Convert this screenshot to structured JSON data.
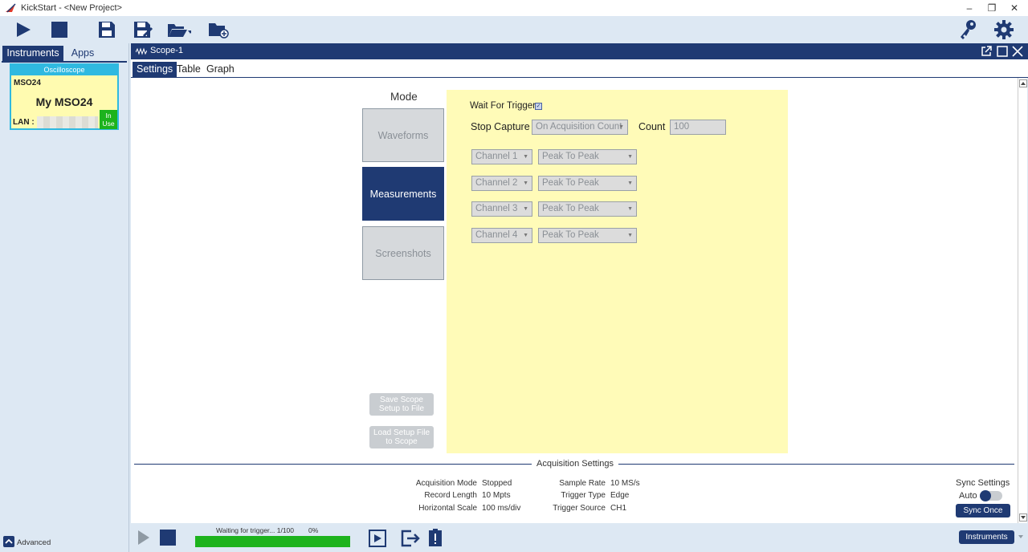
{
  "window": {
    "title": "KickStart - <New Project>",
    "minimize": "–",
    "restore": "❐",
    "close": "✕"
  },
  "left_panel": {
    "tabs": [
      "Instruments",
      "Apps"
    ],
    "card": {
      "type": "Oscilloscope",
      "model": "MSO24",
      "name": "My MSO24",
      "conn_label": "LAN :",
      "status": "In Use"
    },
    "advanced_label": "Advanced"
  },
  "scope": {
    "title": "Scope-1",
    "tabs": [
      "Settings",
      "Table",
      "Graph"
    ],
    "mode_label": "Mode",
    "modes": [
      "Waveforms",
      "Measurements",
      "Screenshots"
    ],
    "selected_mode": "Measurements",
    "wait_for_trigger": {
      "label": "Wait For Trigger",
      "checked": true
    },
    "stop_capture": {
      "label": "Stop Capture",
      "value": "On Acquisition Count"
    },
    "count": {
      "label": "Count",
      "value": "100"
    },
    "measurements": [
      {
        "channel": "Channel 1",
        "type": "Peak To Peak"
      },
      {
        "channel": "Channel 2",
        "type": "Peak To Peak"
      },
      {
        "channel": "Channel 3",
        "type": "Peak To Peak"
      },
      {
        "channel": "Channel 4",
        "type": "Peak To Peak"
      }
    ],
    "save_setup": "Save Scope Setup to File",
    "load_setup": "Load Setup File to Scope"
  },
  "acquisition": {
    "section_title": "Acquisition Settings",
    "left": [
      {
        "label": "Acquisition Mode",
        "value": "Stopped"
      },
      {
        "label": "Record Length",
        "value": "10 Mpts"
      },
      {
        "label": "Horizontal Scale",
        "value": "100 ms/div"
      }
    ],
    "right": [
      {
        "label": "Sample Rate",
        "value": "10 MS/s"
      },
      {
        "label": "Trigger Type",
        "value": "Edge"
      },
      {
        "label": "Trigger Source",
        "value": "CH1"
      }
    ],
    "sync_title": "Sync Settings",
    "auto_label": "Auto",
    "auto_on": false,
    "sync_once": "Sync Once"
  },
  "status": {
    "text": "Waiting for trigger... 1/100",
    "percent": "0%",
    "progress": 1.0
  },
  "bottom": {
    "instruments_button": "Instruments"
  },
  "colors": {
    "navy": "#1f3a73",
    "yellow": "#fffbb8",
    "green": "#1db31d",
    "cyan": "#2fb9e0"
  }
}
